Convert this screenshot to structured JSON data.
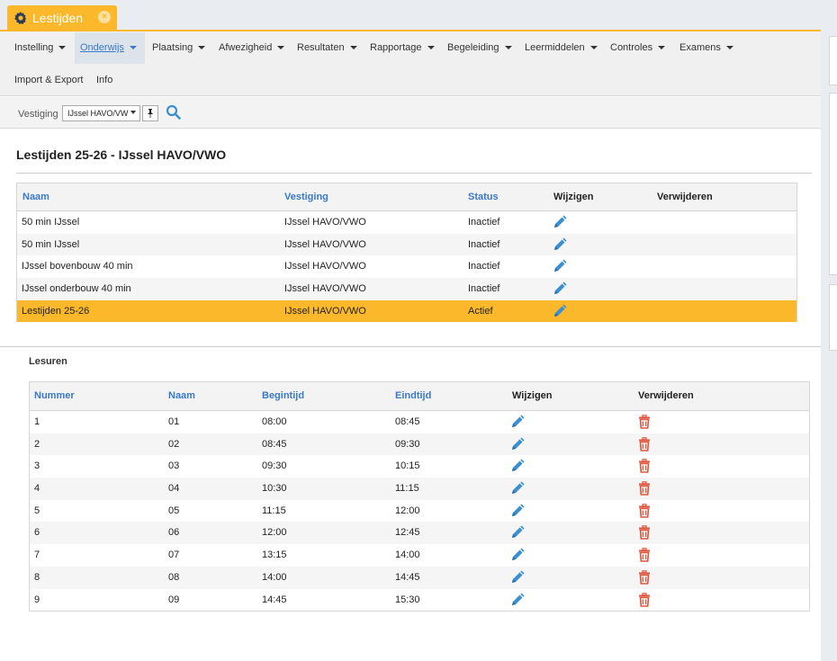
{
  "tab": {
    "title": "Lestijden",
    "icon": "gear-icon",
    "accent": "#fbb82a"
  },
  "menu": {
    "row1": [
      {
        "label": "Instelling"
      },
      {
        "label": "Onderwijs"
      },
      {
        "label": "Plaatsing"
      },
      {
        "label": "Afwezigheid"
      },
      {
        "label": "Resultaten"
      },
      {
        "label": "Rapportage"
      },
      {
        "label": "Begeleiding"
      },
      {
        "label": "Leermiddelen"
      },
      {
        "label": "Controles"
      },
      {
        "label": "Examens"
      }
    ],
    "row2": [
      {
        "label": "Import & Export"
      },
      {
        "label": "Info"
      }
    ]
  },
  "toolbar": {
    "vestiging_label": "Vestiging",
    "vestiging_value": "IJssel HAVO/VW",
    "pin_icon": "pin-icon",
    "search_icon": "search-icon"
  },
  "page": {
    "title": "Lestijden 25-26 - IJssel HAVO/VWO"
  },
  "lestijden": {
    "headers": {
      "naam": "Naam",
      "vestiging": "Vestiging",
      "status": "Status",
      "wijzigen": "Wijzigen",
      "verwijderen": "Verwijderen"
    },
    "rows": [
      {
        "naam": "50 min IJssel",
        "vestiging": "IJssel HAVO/VWO",
        "status": "Inactief"
      },
      {
        "naam": "50 min IJssel",
        "vestiging": "IJssel HAVO/VWO",
        "status": "Inactief"
      },
      {
        "naam": "IJssel bovenbouw 40 min",
        "vestiging": "IJssel HAVO/VWO",
        "status": "Inactief"
      },
      {
        "naam": "IJssel onderbouw 40 min",
        "vestiging": "IJssel HAVO/VWO",
        "status": "Inactief"
      },
      {
        "naam": "Lestijden 25-26",
        "vestiging": "IJssel HAVO/VWO",
        "status": "Actief"
      }
    ]
  },
  "lesuren": {
    "title": "Lesuren",
    "headers": {
      "nummer": "Nummer",
      "naam": "Naam",
      "begintijd": "Begintijd",
      "eindtijd": "Eindtijd",
      "wijzigen": "Wijzigen",
      "verwijderen": "Verwijderen"
    },
    "rows": [
      {
        "nummer": "1",
        "naam": "01",
        "begintijd": "08:00",
        "eindtijd": "08:45"
      },
      {
        "nummer": "2",
        "naam": "02",
        "begintijd": "08:45",
        "eindtijd": "09:30"
      },
      {
        "nummer": "3",
        "naam": "03",
        "begintijd": "09:30",
        "eindtijd": "10:15"
      },
      {
        "nummer": "4",
        "naam": "04",
        "begintijd": "10:30",
        "eindtijd": "11:15"
      },
      {
        "nummer": "5",
        "naam": "05",
        "begintijd": "11:15",
        "eindtijd": "12:00"
      },
      {
        "nummer": "6",
        "naam": "06",
        "begintijd": "12:00",
        "eindtijd": "12:45"
      },
      {
        "nummer": "7",
        "naam": "07",
        "begintijd": "13:15",
        "eindtijd": "14:00"
      },
      {
        "nummer": "8",
        "naam": "08",
        "begintijd": "14:00",
        "eindtijd": "14:45"
      },
      {
        "nummer": "9",
        "naam": "09",
        "begintijd": "14:45",
        "eindtijd": "15:30"
      }
    ]
  },
  "colors": {
    "link": "#3a79c5",
    "selected_row": "#fbb82a",
    "delete": "#e0533c"
  }
}
